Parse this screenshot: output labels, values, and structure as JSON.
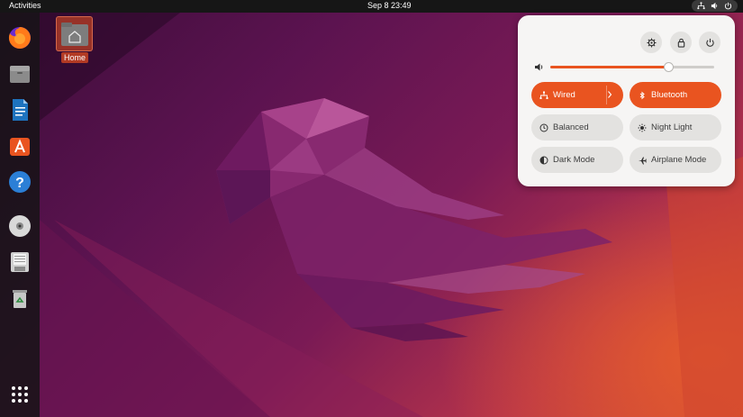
{
  "topbar": {
    "activities": "Activities",
    "clock": "Sep 8  23:49",
    "icons": [
      "network-icon",
      "volume-icon",
      "power-icon"
    ]
  },
  "dock": {
    "apps": [
      "firefox-icon",
      "files-icon",
      "libreoffice-writer-icon",
      "ubuntu-software-icon",
      "help-icon",
      "disc-icon",
      "floppy-icon",
      "trash-icon",
      "show-apps-icon"
    ]
  },
  "desktop": {
    "home_label": "Home"
  },
  "quick_settings": {
    "top_buttons": [
      "settings-icon",
      "lock-icon",
      "power-icon"
    ],
    "volume_level": 0.72,
    "tiles": [
      {
        "label": "Wired",
        "icon": "network-icon",
        "active": true,
        "has_arrow": true
      },
      {
        "label": "Bluetooth",
        "icon": "bluetooth-icon",
        "active": true,
        "has_arrow": false
      },
      {
        "label": "Balanced",
        "icon": "power-profile-icon",
        "active": false,
        "has_arrow": false
      },
      {
        "label": "Night Light",
        "icon": "night-light-icon",
        "active": false,
        "has_arrow": false
      },
      {
        "label": "Dark Mode",
        "icon": "dark-mode-icon",
        "active": false,
        "has_arrow": false
      },
      {
        "label": "Airplane Mode",
        "icon": "airplane-icon",
        "active": false,
        "has_arrow": false
      }
    ]
  },
  "colors": {
    "accent": "#e95420",
    "panel_bg": "#f6f5f4",
    "tile_bg": "#e3e2e0",
    "topbar_bg": "#161616"
  }
}
